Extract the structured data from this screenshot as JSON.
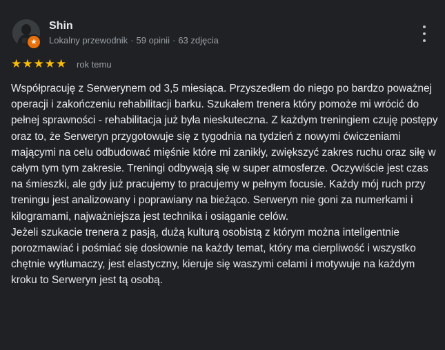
{
  "review": {
    "author_name": "Shin",
    "author_role": "Lokalny przewodnik",
    "separator": "·",
    "review_count": "59 opinii",
    "photo_count": "63 zdjęcia",
    "rating": 5,
    "rating_max": 5,
    "star_color": "#fbbc04",
    "time_ago": "rok temu",
    "paragraphs": [
      "Współpracuję z Serwerynem od 3,5 miesiąca. Przyszedłem do niego po bardzo poważnej operacji i zakończeniu rehabilitacji barku. Szukałem trenera który pomoże mi wrócić do pełnej sprawności - rehabilitacja już była nieskuteczna. Z każdym treningiem czuję postępy oraz to, że Serweryn przygotowuje się z tygodnia na tydzień z nowymi ćwiczeniami mającymi na celu odbudować mięśnie które mi zanikły, zwiększyć zakres ruchu oraz siłę w całym tym tym zakresie. Treningi odbywają się w super atmosferze. Oczywiście jest czas na śmieszki, ale gdy już pracujemy to pracujemy w pełnym focusie. Każdy mój ruch przy treningu jest analizowany i poprawiany na bieżąco. Serweryn nie goni za numerkami i kilogramami, najważniejsza jest technika i osiąganie celów.",
      "Jeżeli szukacie trenera z pasją, dużą kulturą osobistą z którym można inteligentnie porozmawiać i pośmiać się dosłownie na każdy temat, który ma cierpliwość i wszystko chętnie wytłumaczy, jest elastyczny, kieruje się waszymi celami i motywuje na każdym kroku to Serweryn jest tą osobą."
    ]
  },
  "icons": {
    "avatar": "profile-photo",
    "badge": "local-guide-star-icon",
    "menu": "more-vert-icon",
    "star": "star-icon"
  },
  "colors": {
    "background": "#202124",
    "text": "#e8eaed",
    "secondary_text": "#9aa0a6",
    "badge": "#e8710a"
  }
}
